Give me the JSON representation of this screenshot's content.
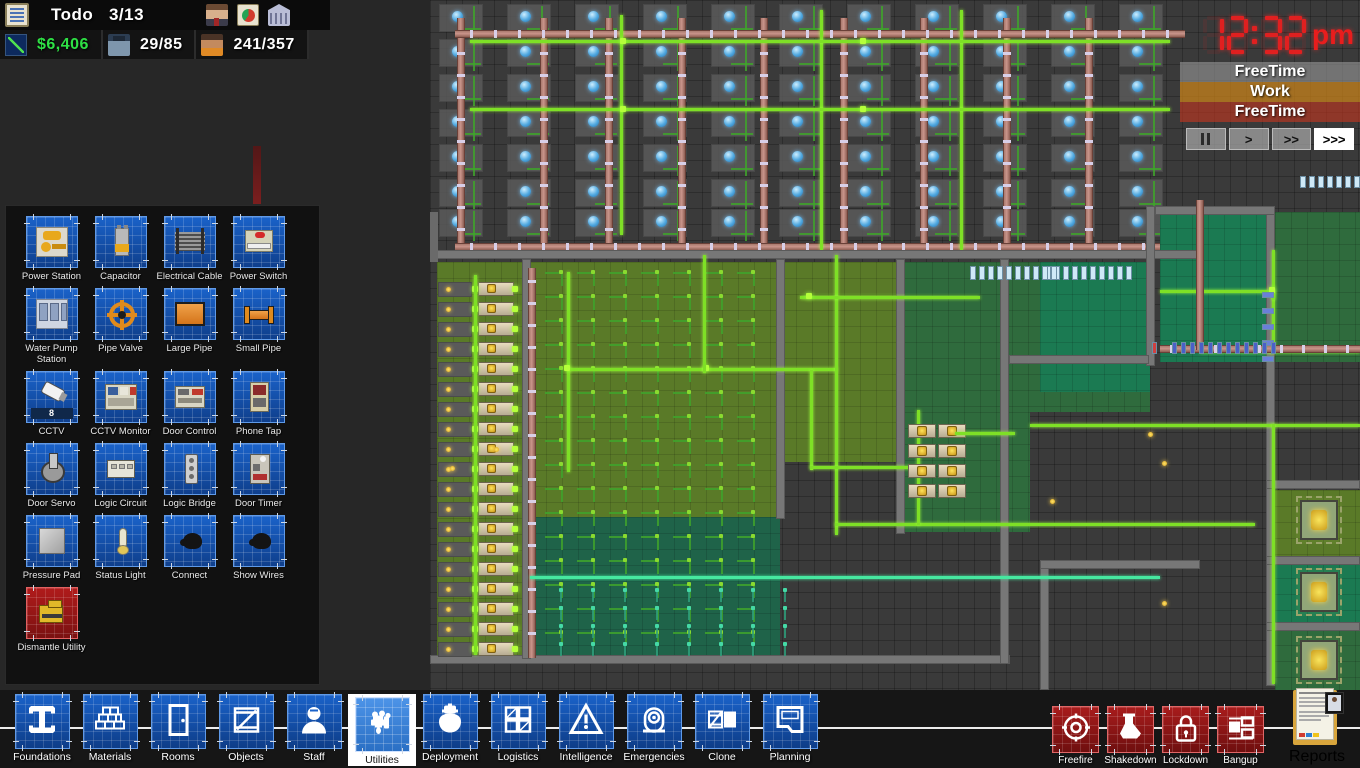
{
  "hud": {
    "todo_label": "Todo",
    "todo_count": "3/13",
    "clipboard_icon": "clipboard-icon",
    "warden_icon": "warden-portrait-icon",
    "pie_icon": "finance-report-icon",
    "bank_icon": "bank-icon",
    "stats": [
      {
        "icon": "finance-graph-icon",
        "value": "$6,406",
        "name": "money"
      },
      {
        "icon": "guard-icon",
        "value": "29/85",
        "name": "staff"
      },
      {
        "icon": "prisoner-icon",
        "value": "241/357",
        "name": "prisoners"
      }
    ]
  },
  "clock": {
    "digits": "1232",
    "time_text": "12:32",
    "ampm": "pm",
    "schedule": [
      {
        "label": "FreeTime",
        "color": "#969696"
      },
      {
        "label": "Work",
        "color": "#d68918"
      },
      {
        "label": "FreeTime",
        "color": "#c4361e"
      }
    ],
    "speed_buttons": [
      {
        "name": "pause",
        "label": "II",
        "active": false
      },
      {
        "name": "play",
        "label": ">",
        "active": false
      },
      {
        "name": "fast-forward",
        "label": ">>",
        "active": false
      },
      {
        "name": "fastest-forward",
        "label": ">>>",
        "active": true
      }
    ]
  },
  "utilities_panel": {
    "items": [
      {
        "name": "power-station",
        "label": "Power Station",
        "icon": "power-station-icon",
        "style": "power"
      },
      {
        "name": "capacitor",
        "label": "Capacitor",
        "icon": "capacitor-icon",
        "style": "capacitor"
      },
      {
        "name": "electrical-cable",
        "label": "Electrical Cable",
        "icon": "electrical-cable-icon",
        "style": "cable"
      },
      {
        "name": "power-switch",
        "label": "Power Switch",
        "icon": "power-switch-icon",
        "style": "switch"
      },
      {
        "name": "water-pump-station",
        "label": "Water Pump Station",
        "icon": "water-pump-icon",
        "style": "pump"
      },
      {
        "name": "pipe-valve",
        "label": "Pipe Valve",
        "icon": "pipe-valve-icon",
        "style": "valve"
      },
      {
        "name": "large-pipe",
        "label": "Large Pipe",
        "icon": "large-pipe-icon",
        "style": "largepipe"
      },
      {
        "name": "small-pipe",
        "label": "Small Pipe",
        "icon": "small-pipe-icon",
        "style": "smallpipe"
      },
      {
        "name": "cctv",
        "label": "CCTV",
        "icon": "cctv-camera-icon",
        "style": "cctv",
        "badge": "8"
      },
      {
        "name": "cctv-monitor",
        "label": "CCTV Monitor",
        "icon": "cctv-monitor-icon",
        "style": "monitor"
      },
      {
        "name": "door-control",
        "label": "Door Control",
        "icon": "door-control-icon",
        "style": "doorctl"
      },
      {
        "name": "phone-tap",
        "label": "Phone Tap",
        "icon": "phone-tap-icon",
        "style": "phonetap"
      },
      {
        "name": "door-servo",
        "label": "Door Servo",
        "icon": "door-servo-icon",
        "style": "servo"
      },
      {
        "name": "logic-circuit",
        "label": "Logic Circuit",
        "icon": "logic-circuit-icon",
        "style": "logicc"
      },
      {
        "name": "logic-bridge",
        "label": "Logic Bridge",
        "icon": "logic-bridge-icon",
        "style": "logicb"
      },
      {
        "name": "door-timer",
        "label": "Door Timer",
        "icon": "door-timer-icon",
        "style": "timer"
      },
      {
        "name": "pressure-pad",
        "label": "Pressure Pad",
        "icon": "pressure-pad-icon",
        "style": "pad"
      },
      {
        "name": "status-light",
        "label": "Status Light",
        "icon": "status-light-icon",
        "style": "statuslight"
      },
      {
        "name": "connect",
        "label": "Connect",
        "icon": "connect-icon",
        "style": "connect"
      },
      {
        "name": "show-wires",
        "label": "Show Wires",
        "icon": "show-wires-icon",
        "style": "connect"
      },
      {
        "name": "dismantle-utility",
        "label": "Dismantle Utility",
        "icon": "dismantle-icon",
        "style": "dismantle",
        "red": true
      }
    ]
  },
  "toolbar": {
    "items": [
      {
        "name": "foundations",
        "label": "Foundations",
        "icon": "foundation-icon",
        "selected": false
      },
      {
        "name": "materials",
        "label": "Materials",
        "icon": "brick-wall-icon",
        "selected": false
      },
      {
        "name": "rooms",
        "label": "Rooms",
        "icon": "door-icon",
        "selected": false
      },
      {
        "name": "objects",
        "label": "Objects",
        "icon": "object-icon",
        "selected": false
      },
      {
        "name": "staff",
        "label": "Staff",
        "icon": "person-icon",
        "selected": false
      },
      {
        "name": "utilities",
        "label": "Utilities",
        "icon": "faucet-icon",
        "selected": true
      },
      {
        "name": "deployment",
        "label": "Deployment",
        "icon": "guard-badge-icon",
        "selected": false
      },
      {
        "name": "logistics",
        "label": "Logistics",
        "icon": "grid-squares-icon",
        "selected": false
      },
      {
        "name": "intelligence",
        "label": "Intelligence",
        "icon": "warning-triangle-icon",
        "selected": false
      },
      {
        "name": "emergencies",
        "label": "Emergencies",
        "icon": "siren-icon",
        "selected": false
      },
      {
        "name": "clone",
        "label": "Clone",
        "icon": "clone-icon",
        "selected": false
      },
      {
        "name": "planning",
        "label": "Planning",
        "icon": "blueprint-icon",
        "selected": false
      }
    ],
    "emergency": [
      {
        "name": "freefire",
        "label": "Freefire",
        "icon": "freefire-icon"
      },
      {
        "name": "shakedown",
        "label": "Shakedown",
        "icon": "shakedown-icon"
      },
      {
        "name": "lockdown",
        "label": "Lockdown",
        "icon": "padlock-icon"
      },
      {
        "name": "bangup",
        "label": "Bangup",
        "icon": "bangup-icon"
      }
    ],
    "reports": {
      "name": "reports",
      "label": "Reports",
      "icon": "reports-clipboard-icon"
    }
  }
}
